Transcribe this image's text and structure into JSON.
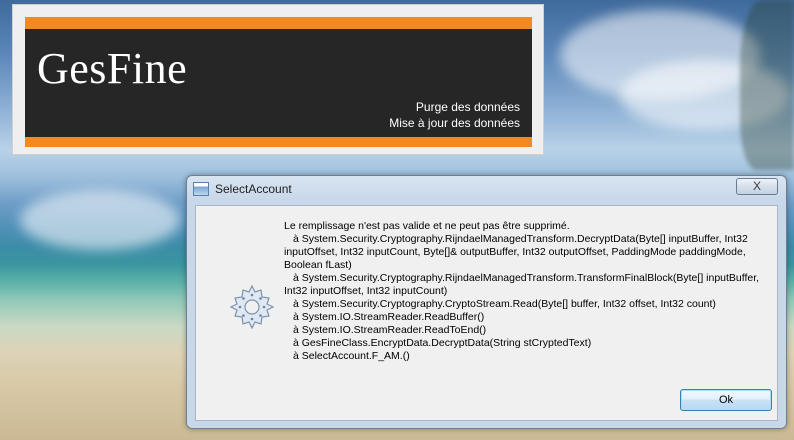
{
  "banner": {
    "brand": "GesFine",
    "menu": [
      "Purge des données",
      "Mise à jour des données"
    ],
    "colors": {
      "accent": "#f08a24",
      "panel": "#262626"
    }
  },
  "dialog": {
    "title": "SelectAccount",
    "close_label": "X",
    "icon": "gear-icon",
    "message_lines": [
      "Le remplissage n'est pas valide et ne peut pas être supprimé.",
      "à System.Security.Cryptography.RijndaelManagedTransform.DecryptData(Byte[] inputBuffer, Int32",
      "inputOffset, Int32 inputCount, Byte[]& outputBuffer, Int32 outputOffset, PaddingMode paddingMode,",
      "Boolean fLast)",
      "à System.Security.Cryptography.RijndaelManagedTransform.TransformFinalBlock(Byte[] inputBuffer,",
      "Int32 inputOffset, Int32 inputCount)",
      "à System.Security.Cryptography.CryptoStream.Read(Byte[] buffer, Int32 offset, Int32 count)",
      "à System.IO.StreamReader.ReadBuffer()",
      "à System.IO.StreamReader.ReadToEnd()",
      "à GesFineClass.EncryptData.DecryptData(String stCryptedText)",
      "à SelectAccount.F_AM.()"
    ],
    "ok_label": "Ok"
  }
}
